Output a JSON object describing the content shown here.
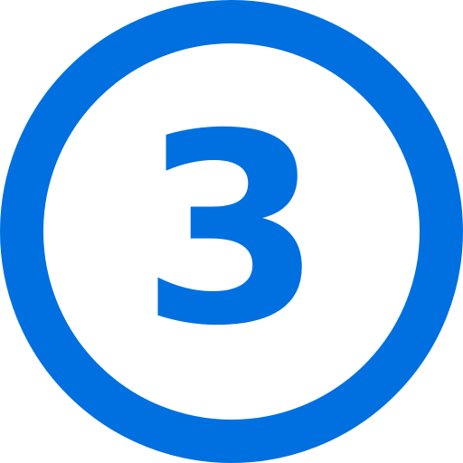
{
  "icon": {
    "name": "number-3-circle-icon",
    "digit": "3",
    "color": "#0070E0",
    "background": "#FFFFFF"
  }
}
